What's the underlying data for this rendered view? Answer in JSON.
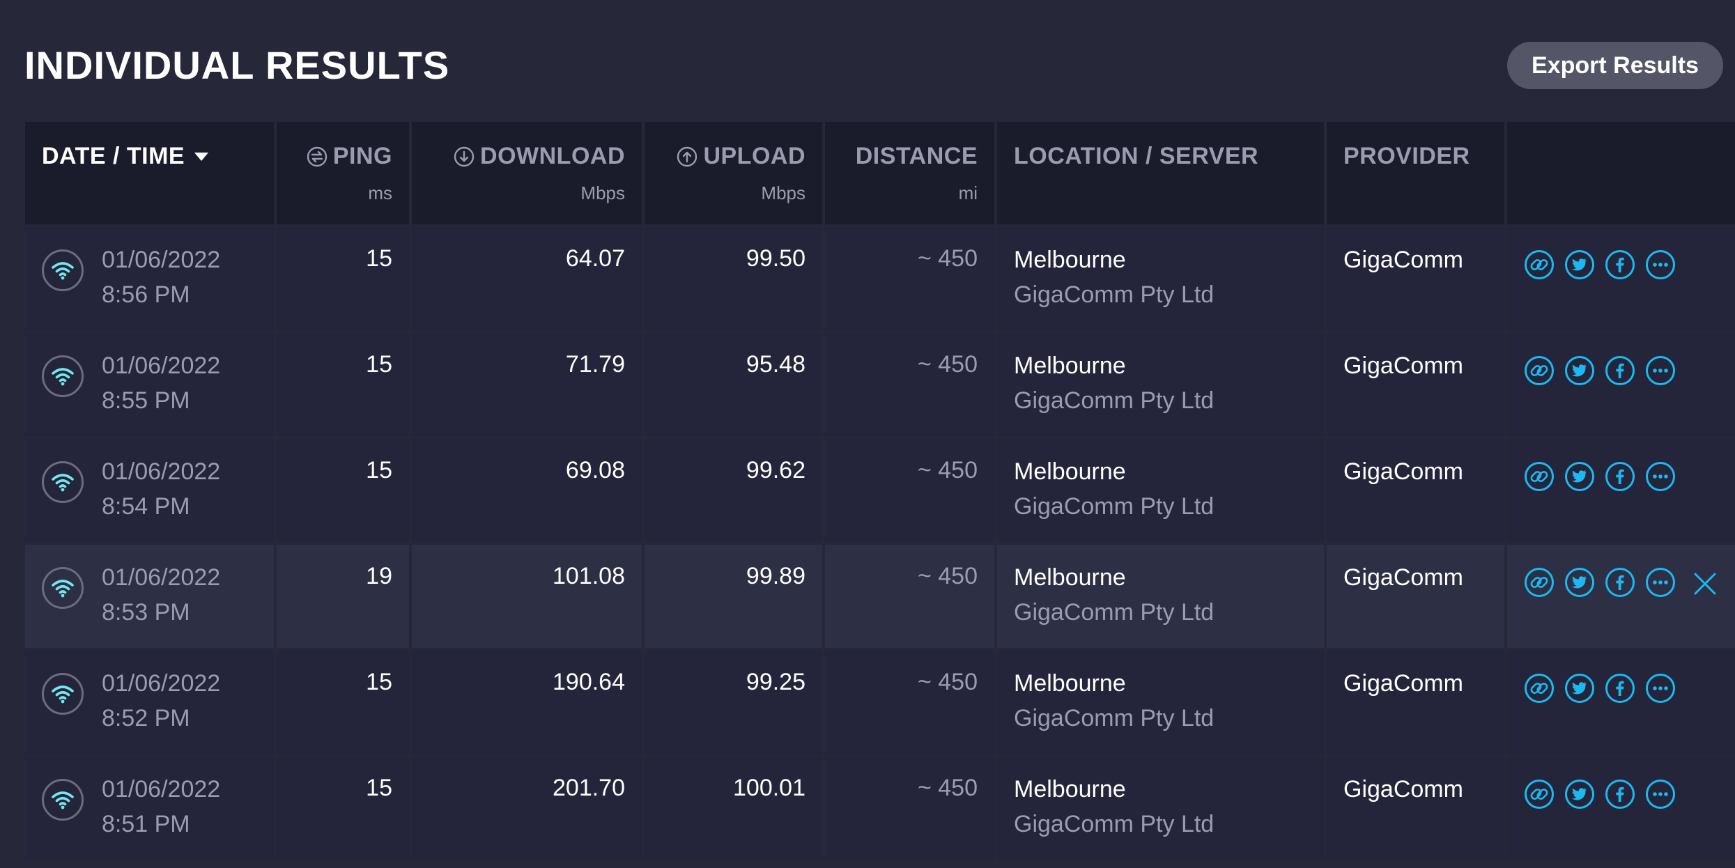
{
  "title": "INDIVIDUAL RESULTS",
  "export_label": "Export Results",
  "columns": {
    "datetime": {
      "label": "DATE / TIME"
    },
    "ping": {
      "label": "PING",
      "unit": "ms"
    },
    "download": {
      "label": "DOWNLOAD",
      "unit": "Mbps"
    },
    "upload": {
      "label": "UPLOAD",
      "unit": "Mbps"
    },
    "distance": {
      "label": "DISTANCE",
      "unit": "mi"
    },
    "location": {
      "label": "LOCATION / SERVER"
    },
    "provider": {
      "label": "PROVIDER"
    }
  },
  "rows": [
    {
      "date": "01/06/2022",
      "time": "8:56 PM",
      "ping": "15",
      "download": "64.07",
      "upload": "99.50",
      "distance": "~ 450",
      "city": "Melbourne",
      "sponsor": "GigaComm Pty Ltd",
      "provider": "GigaComm"
    },
    {
      "date": "01/06/2022",
      "time": "8:55 PM",
      "ping": "15",
      "download": "71.79",
      "upload": "95.48",
      "distance": "~ 450",
      "city": "Melbourne",
      "sponsor": "GigaComm Pty Ltd",
      "provider": "GigaComm"
    },
    {
      "date": "01/06/2022",
      "time": "8:54 PM",
      "ping": "15",
      "download": "69.08",
      "upload": "99.62",
      "distance": "~ 450",
      "city": "Melbourne",
      "sponsor": "GigaComm Pty Ltd",
      "provider": "GigaComm"
    },
    {
      "date": "01/06/2022",
      "time": "8:53 PM",
      "ping": "19",
      "download": "101.08",
      "upload": "99.89",
      "distance": "~ 450",
      "city": "Melbourne",
      "sponsor": "GigaComm Pty Ltd",
      "provider": "GigaComm"
    },
    {
      "date": "01/06/2022",
      "time": "8:52 PM",
      "ping": "15",
      "download": "190.64",
      "upload": "99.25",
      "distance": "~ 450",
      "city": "Melbourne",
      "sponsor": "GigaComm Pty Ltd",
      "provider": "GigaComm"
    },
    {
      "date": "01/06/2022",
      "time": "8:51 PM",
      "ping": "15",
      "download": "201.70",
      "upload": "100.01",
      "distance": "~ 450",
      "city": "Melbourne",
      "sponsor": "GigaComm Pty Ltd",
      "provider": "GigaComm"
    }
  ],
  "row_icons": [
    "link-icon",
    "twitter-icon",
    "facebook-icon",
    "more-icon"
  ],
  "colors": {
    "background": "#262739",
    "header_bg": "#1b1c2b",
    "row_bg": "#24253a",
    "row_highlight": "#2d2f45",
    "accent": "#1cb8f0",
    "wifi": "#76e6ee",
    "muted": "#9b9cb0"
  }
}
